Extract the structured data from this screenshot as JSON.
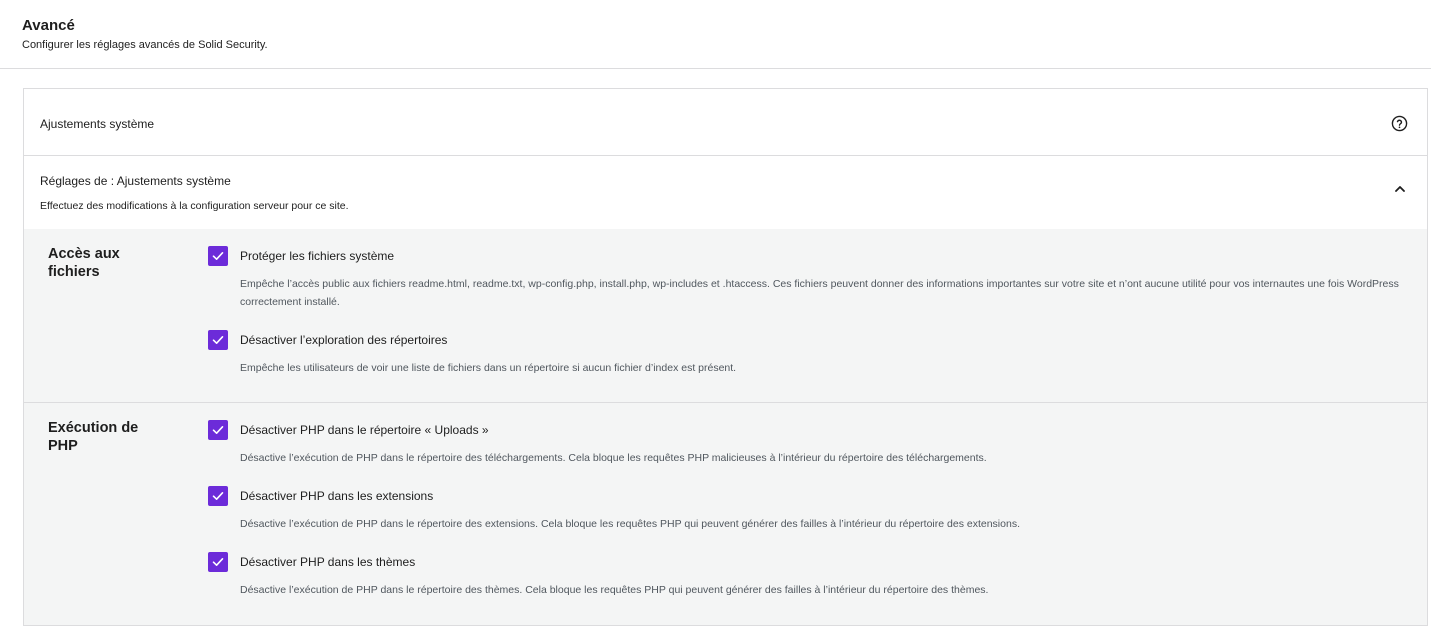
{
  "header": {
    "title": "Avancé",
    "description": "Configurer les réglages avancés de Solid Security."
  },
  "card": {
    "title": "Ajustements système",
    "help_icon": "help-circle-icon",
    "settings_title": "Réglages de : Ajustements système",
    "settings_description": "Effectuez des modifications à la configuration serveur pour ce site.",
    "collapse_icon": "chevron-up-icon"
  },
  "sections": [
    {
      "label": "Accès aux fichiers",
      "options": [
        {
          "label": "Protéger les fichiers système",
          "checked": true,
          "description": "Empêche l’accès public aux fichiers readme.html, readme.txt, wp-config.php, install.php, wp-includes et .htaccess. Ces fichiers peuvent donner des informations importantes sur votre site et n’ont aucune utilité pour vos internautes une fois WordPress correctement installé."
        },
        {
          "label": "Désactiver l’exploration des répertoires",
          "checked": true,
          "description": "Empêche les utilisateurs de voir une liste de fichiers dans un répertoire si aucun fichier d’index est présent."
        }
      ]
    },
    {
      "label": "Exécution de PHP",
      "options": [
        {
          "label": "Désactiver PHP dans le répertoire « Uploads »",
          "checked": true,
          "description": "Désactive l’exécution de PHP dans le répertoire des téléchargements. Cela bloque les requêtes PHP malicieuses à l’intérieur du répertoire des téléchargements."
        },
        {
          "label": "Désactiver PHP dans les extensions",
          "checked": true,
          "description": "Désactive l’exécution de PHP dans le répertoire des extensions. Cela bloque les requêtes PHP qui peuvent générer des failles à l’intérieur du répertoire des extensions."
        },
        {
          "label": "Désactiver PHP dans les thèmes",
          "checked": true,
          "description": "Désactive l’exécution de PHP dans le répertoire des thèmes. Cela bloque les requêtes PHP qui peuvent générer des failles à l’intérieur du répertoire des thèmes."
        }
      ]
    }
  ],
  "colors": {
    "accent": "#6c2bd9",
    "panel_bg": "#f4f5f5",
    "border": "#dcdcde"
  }
}
